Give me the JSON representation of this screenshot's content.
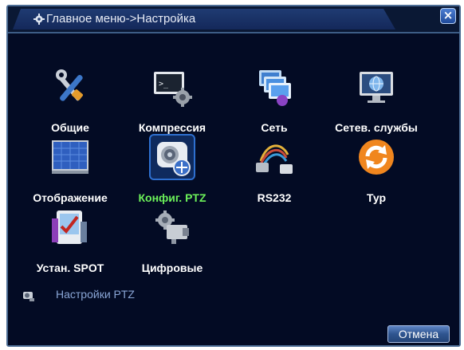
{
  "window": {
    "title": "Главное меню->Настройка",
    "close_symbol": "×"
  },
  "menu": {
    "items": [
      {
        "label": "Общие",
        "icon": "tools-icon",
        "selected": false
      },
      {
        "label": "Компрессия",
        "icon": "compression-icon",
        "selected": false
      },
      {
        "label": "Сеть",
        "icon": "network-icon",
        "selected": false
      },
      {
        "label": "Сетев. службы",
        "icon": "net-services-icon",
        "selected": false
      },
      {
        "label": "Отображение",
        "icon": "display-icon",
        "selected": false
      },
      {
        "label": "Конфиг. PTZ",
        "icon": "ptz-camera-icon",
        "selected": true
      },
      {
        "label": "RS232",
        "icon": "cable-icon",
        "selected": false
      },
      {
        "label": "Тур",
        "icon": "tour-icon",
        "selected": false
      },
      {
        "label": "Устан. SPOT",
        "icon": "spot-icon",
        "selected": false
      },
      {
        "label": "Цифровые",
        "icon": "digital-camera-icon",
        "selected": false
      }
    ]
  },
  "status": {
    "text": "Настройки PTZ"
  },
  "footer": {
    "cancel_label": "Отмена"
  },
  "colors": {
    "background": "#030b24",
    "selected_label": "#6cf25a",
    "label": "#ffffff",
    "status_text": "#8aa6d6"
  }
}
